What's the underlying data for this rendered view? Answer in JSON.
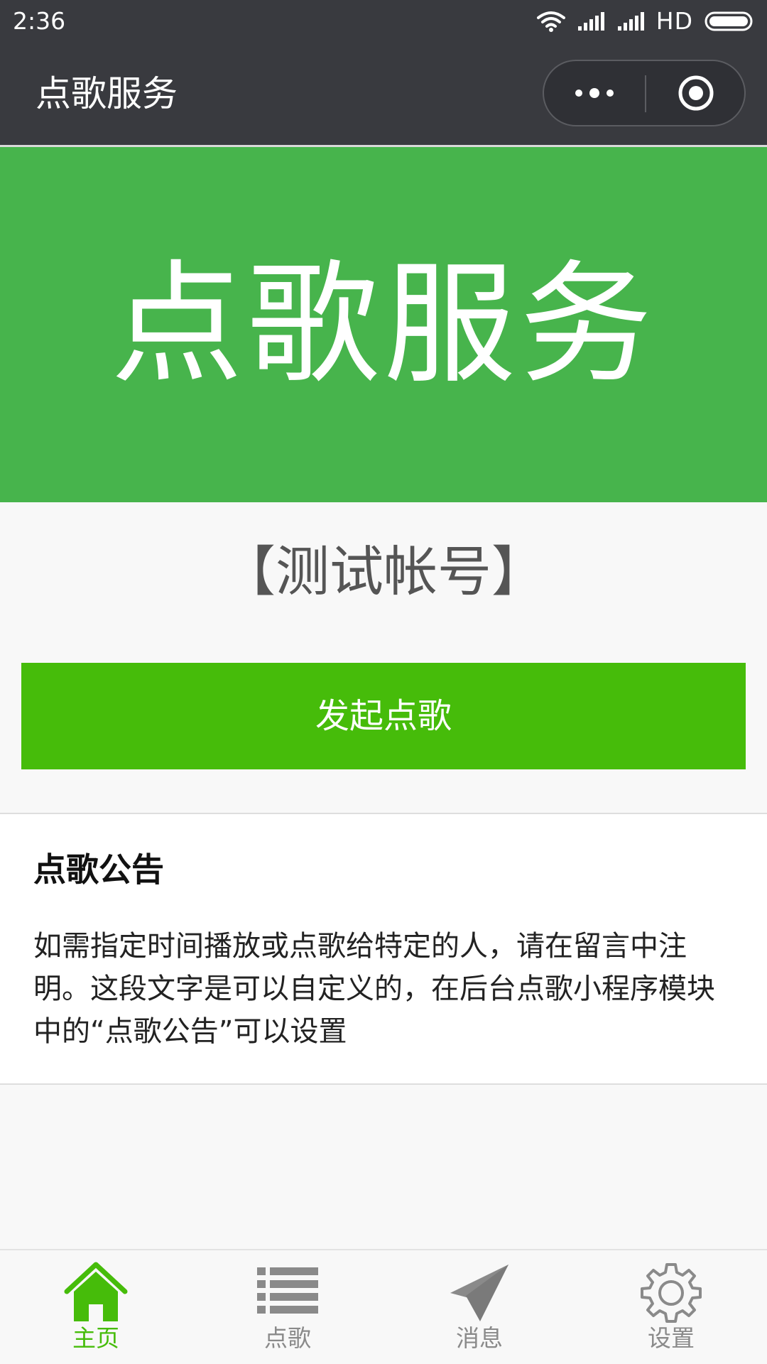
{
  "status_bar": {
    "time": "2:36",
    "network": "HD"
  },
  "nav": {
    "title": "点歌服务"
  },
  "banner": {
    "text": "点歌服务"
  },
  "account": {
    "label": "【测试帐号】"
  },
  "actions": {
    "request_song": "发起点歌"
  },
  "notice": {
    "title": "点歌公告",
    "body": "如需指定时间播放或点歌给特定的人，请在留言中注明。这段文字是可以自定义的，在后台点歌小程序模块中的“点歌公告”可以设置"
  },
  "tabs": [
    {
      "label": "主页",
      "icon": "home-icon",
      "active": true
    },
    {
      "label": "点歌",
      "icon": "list-icon",
      "active": false
    },
    {
      "label": "消息",
      "icon": "paper-plane-icon",
      "active": false
    },
    {
      "label": "设置",
      "icon": "gear-icon",
      "active": false
    }
  ],
  "colors": {
    "nav_bg": "#393a3f",
    "banner_bg": "#47b44c",
    "button_bg": "#46bc0a",
    "tab_active": "#46bc0a",
    "tab_inactive": "#8a8a8a"
  }
}
